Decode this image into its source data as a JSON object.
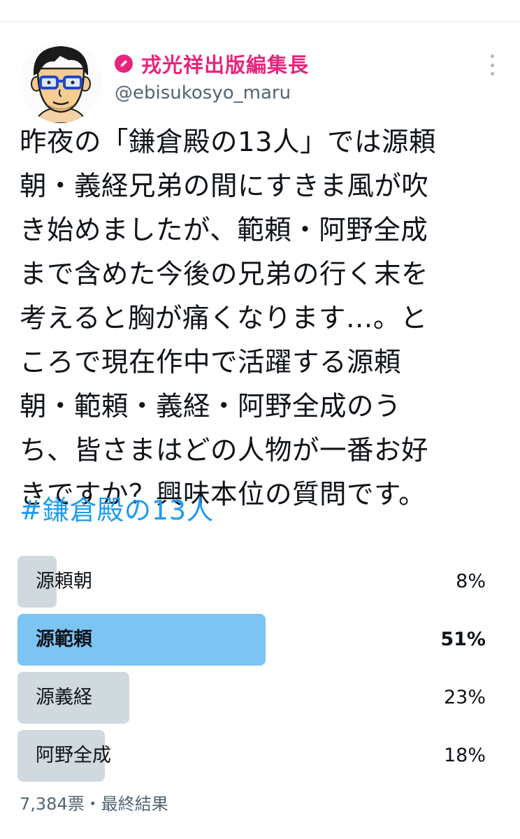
{
  "user": {
    "display_name": "戎光祥出版編集長",
    "handle": "@ebisukosyo_maru",
    "badge_color": "#e8257c"
  },
  "tweet": {
    "text": "昨夜の「鎌倉殿の13人」では源頼\n朝・義経兄弟の間にすきま風が吹\nき始めましたが、範頼・阿野全成\nまで含めた今後の兄弟の行く末を\n考えると胸が痛くなります…。と\nころで現在作中で活躍する源頼\n朝・範頼・義経・阿野全成のう\nち、皆さまはどの人物が一番お好\nきですか？興味本位の質問です。",
    "hashtag": "#鎌倉殿の13人"
  },
  "poll": {
    "options": [
      {
        "label": "源頼朝",
        "percent_text": "8%",
        "share": 0.08,
        "winner": false
      },
      {
        "label": "源範頼",
        "percent_text": "51%",
        "share": 0.51,
        "winner": true
      },
      {
        "label": "源義経",
        "percent_text": "23%",
        "share": 0.23,
        "winner": false
      },
      {
        "label": "阿野全成",
        "percent_text": "18%",
        "share": 0.18,
        "winner": false
      }
    ],
    "footer": "7,384票・最終結果"
  },
  "colors": {
    "winner_bar": "#7cc4f4",
    "other_bar": "#cfd9de",
    "hashtag": "#1d9bf0",
    "muted": "#536471"
  }
}
